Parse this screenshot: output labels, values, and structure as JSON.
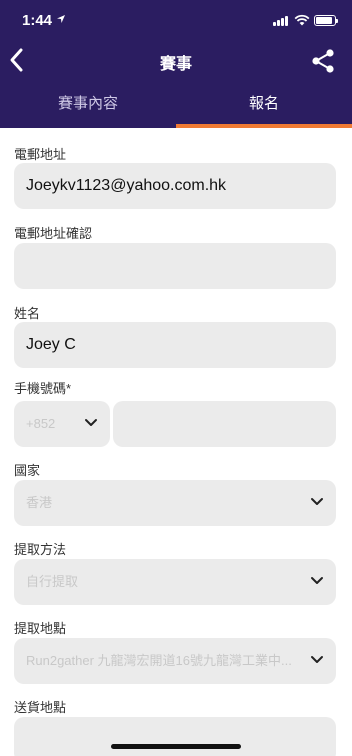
{
  "status_bar": {
    "time": "1:44"
  },
  "header": {
    "title": "賽事"
  },
  "tabs": [
    {
      "label": "賽事內容",
      "active": false
    },
    {
      "label": "報名",
      "active": true
    }
  ],
  "form": {
    "email": {
      "label": "電郵地址",
      "value": "Joeykv1123@yahoo.com.hk"
    },
    "email_confirm": {
      "label": "電郵地址確認",
      "value": ""
    },
    "name": {
      "label": "姓名",
      "value": "Joey C"
    },
    "phone": {
      "label": "手機號碼*",
      "country_code": "+852",
      "number": ""
    },
    "country": {
      "label": "國家",
      "value": "香港"
    },
    "pickup_method": {
      "label": "提取方法",
      "value": "自行提取"
    },
    "pickup_location": {
      "label": "提取地點",
      "value": "Run2gather 九龍灣宏開道16號九龍灣工業中..."
    },
    "delivery_location": {
      "label": "送貨地點"
    }
  },
  "colors": {
    "header_bg": "#2b1d61",
    "accent": "#f07a33",
    "field_bg": "#ebebeb"
  }
}
